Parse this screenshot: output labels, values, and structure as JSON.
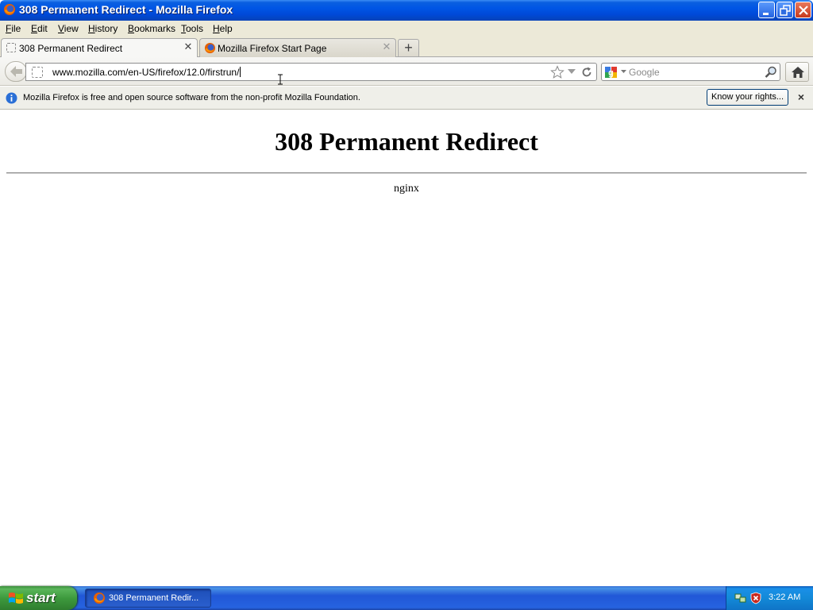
{
  "window": {
    "title": "308 Permanent Redirect - Mozilla Firefox"
  },
  "menu": {
    "items": [
      "File",
      "Edit",
      "View",
      "History",
      "Bookmarks",
      "Tools",
      "Help"
    ]
  },
  "tabs": [
    {
      "label": "308 Permanent Redirect",
      "active": true
    },
    {
      "label": "Mozilla Firefox Start Page",
      "active": false
    }
  ],
  "navbar": {
    "url": "www.mozilla.com/en-US/firefox/12.0/firstrun/",
    "search_placeholder": "Google"
  },
  "notification": {
    "text": "Mozilla Firefox is free and open source software from the non-profit Mozilla Foundation.",
    "button_label": "Know your rights..."
  },
  "page": {
    "heading": "308 Permanent Redirect",
    "server": "nginx"
  },
  "taskbar": {
    "start_label": "start",
    "task_label": "308 Permanent Redir...",
    "clock": "3:22 AM"
  },
  "colors": {
    "titlebar": "#0055e5",
    "taskbar": "#2157d7",
    "start_button": "#3d9a3d"
  }
}
